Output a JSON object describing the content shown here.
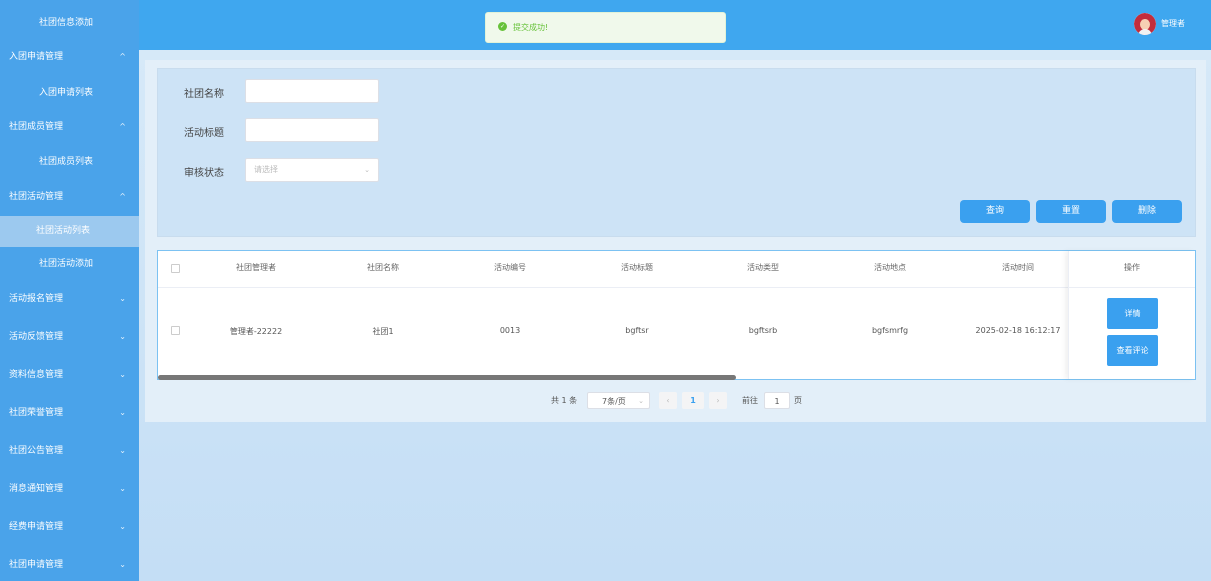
{
  "sidebar": {
    "items": [
      {
        "label": "社团信息添加",
        "type": "sub"
      },
      {
        "label": "入团申请管理",
        "type": "group",
        "chevron": "^"
      },
      {
        "label": "入团申请列表",
        "type": "sub"
      },
      {
        "label": "社团成员管理",
        "type": "group",
        "chevron": "^"
      },
      {
        "label": "社团成员列表",
        "type": "sub"
      },
      {
        "label": "社团活动管理",
        "type": "group",
        "chevron": "^"
      },
      {
        "label": "社团活动列表",
        "type": "active"
      },
      {
        "label": "社团活动添加",
        "type": "sub"
      },
      {
        "label": "活动报名管理",
        "type": "group",
        "chevron": "⌄"
      },
      {
        "label": "活动反馈管理",
        "type": "group",
        "chevron": "⌄"
      },
      {
        "label": "资料信息管理",
        "type": "group",
        "chevron": "⌄"
      },
      {
        "label": "社团荣誉管理",
        "type": "group",
        "chevron": "⌄"
      },
      {
        "label": "社团公告管理",
        "type": "group",
        "chevron": "⌄"
      },
      {
        "label": "消息通知管理",
        "type": "group",
        "chevron": "⌄"
      },
      {
        "label": "经费申请管理",
        "type": "group",
        "chevron": "⌄"
      },
      {
        "label": "社团申请管理",
        "type": "group",
        "chevron": "⌄"
      }
    ]
  },
  "header": {
    "toast": "提交成功!",
    "user": "管理者"
  },
  "search": {
    "club_name_label": "社团名称",
    "activity_title_label": "活动标题",
    "review_status_label": "审核状态",
    "review_status_placeholder": "请选择",
    "club_name_value": "",
    "activity_title_value": ""
  },
  "buttons": {
    "query": "查询",
    "reset": "重置",
    "delete": "删除"
  },
  "table": {
    "headers": [
      "社团管理者",
      "社团名称",
      "活动编号",
      "活动标题",
      "活动类型",
      "活动地点",
      "活动时间",
      "操作"
    ],
    "rows": [
      {
        "manager": "管理者-22222",
        "club": "社团1",
        "number": "0013",
        "title": "bgftsr",
        "type": "bgftsrb",
        "location": "bgfsmrfg",
        "time": "2025-02-18 16:12:17",
        "detail_btn": "详情",
        "review_btn": "查看评论"
      }
    ]
  },
  "pagination": {
    "total": "共 1 条",
    "page_size": "7条/页",
    "current": "1",
    "goto_label": "前往",
    "goto_value": "1",
    "page_suffix": "页"
  },
  "colors": {
    "sidebar": "#4aa3ea",
    "topbar": "#3fa7ef",
    "accent": "#3aa0ef",
    "success": "#67c23a"
  }
}
